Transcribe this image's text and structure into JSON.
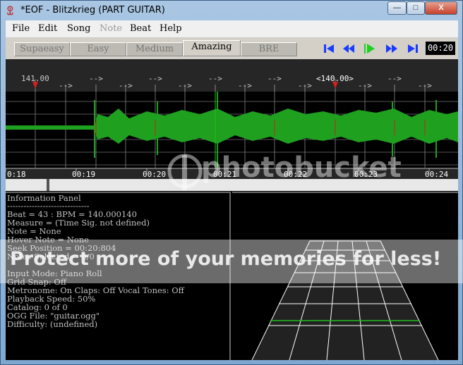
{
  "window": {
    "title": "*EOF - Blitzkrieg (PART GUITAR)",
    "minimize_label": "—",
    "maximize_label": "□",
    "close_label": "X"
  },
  "menu": [
    "File",
    "Edit",
    "Song",
    "Note",
    "Beat",
    "Help"
  ],
  "difficulty_tabs": [
    "Supaeasy",
    "Easy",
    "Medium",
    "Amazing",
    "BRE"
  ],
  "active_tab": "Amazing",
  "time_display": "00:20",
  "ruler": {
    "tempo_start": "141.00",
    "tempo_mid": "<140.00>",
    "arrow": "-->",
    "times": [
      "0:18",
      "00:19",
      "00:20",
      "00:21",
      "00:22",
      "00:23",
      "00:24"
    ]
  },
  "info": {
    "title": "Information Panel",
    "separator": "------------------------------",
    "beat": "Beat = 43 : BPM = 140.000140",
    "measure": "Measure = (Time Sig. not defined)",
    "note": "Note = None",
    "hover_note": "Hover Note = None",
    "seek": "Seek Position = 00:20:804",
    "notes_selected": "Notes Selected = 0/0",
    "input_mode": "Input Mode: Piano Roll",
    "grid_snap": "Grid Snap: Off",
    "metronome": "Metronome: On Claps: Off Vocal Tones: Off",
    "playback": "Playback Speed: 50%",
    "catalog": "Catalog: 0 of 0",
    "ogg": "OGG File: \"guitar.ogg\"",
    "difficulty": "Difficulty: (undefined)"
  },
  "watermark": {
    "logo": "photobucket",
    "message": "Protect more of your memories for less!"
  },
  "colors": {
    "waveform": "#1fa01f",
    "beat_marker": "#d02020",
    "fretboard_lines": "#ffffff",
    "active_line": "#20c020"
  }
}
